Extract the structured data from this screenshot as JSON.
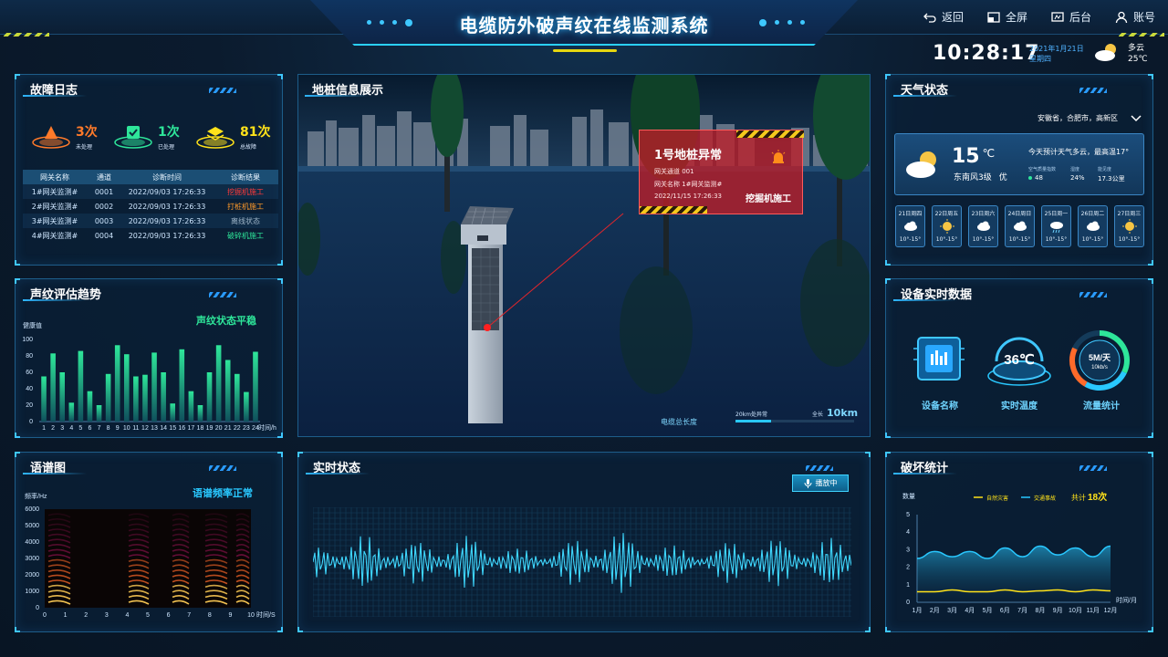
{
  "header": {
    "title": "电缆防外破声纹在线监测系统",
    "nav": [
      {
        "label": "返回",
        "icon": "back-icon"
      },
      {
        "label": "全屏",
        "icon": "fullscreen-icon"
      },
      {
        "label": "后台",
        "icon": "backend-icon"
      },
      {
        "label": "账号",
        "icon": "account-icon"
      }
    ],
    "time": "10:28:17",
    "date": "2021年1月21日",
    "weekday": "星期四",
    "weather": "多云",
    "temp": "25℃"
  },
  "fault_log": {
    "title": "故障日志",
    "stats": [
      {
        "count": "3次",
        "label": "未处理",
        "color": "#ff7a2a"
      },
      {
        "count": "1次",
        "label": "已处理",
        "color": "#2ee69a"
      },
      {
        "count": "81次",
        "label": "总故障",
        "color": "#ffe21a"
      }
    ],
    "columns": [
      "网关名称",
      "通道",
      "诊断时间",
      "诊断结果"
    ],
    "rows": [
      {
        "name": "1#网关监测#",
        "ch": "0001",
        "time": "2022/09/03 17:26:33",
        "result": "挖掘机施工",
        "color": "#ff3a3a"
      },
      {
        "name": "2#网关监测#",
        "ch": "0002",
        "time": "2022/09/03 17:26:33",
        "result": "打桩机施工",
        "color": "#ff9a2a"
      },
      {
        "name": "3#网关监测#",
        "ch": "0003",
        "time": "2022/09/03 17:26:33",
        "result": "离线状态",
        "color": "#9fb6c9"
      },
      {
        "name": "4#网关监测#",
        "ch": "0004",
        "time": "2022/09/03 17:26:33",
        "result": "破碎机施工",
        "color": "#2ee69a"
      }
    ]
  },
  "trend": {
    "title": "声纹评估趋势",
    "status": "声纹状态平稳"
  },
  "spectro": {
    "title": "语谱图",
    "status": "语谱频率正常"
  },
  "center": {
    "title": "地桩信息展示",
    "alert_title": "1号地桩异常",
    "alert_lines": [
      "网关通道    001",
      "网关名称    1#网关监测#",
      "2022/11/15 17:26:33"
    ],
    "alert_result": "挖掘机施工",
    "cable_label": "电缆总长度",
    "progress_label": "20km处异常",
    "total_prefix": "全长",
    "total_value": "10km",
    "progress": 0.3
  },
  "weather": {
    "title": "天气状态",
    "location": "安徽省，合肥市，高新区",
    "temp": "15",
    "unit": "℃",
    "wind": "东南风3级",
    "quality": "优",
    "forecast_text": "今天预计天气多云，最高温17°",
    "aqi_label": "空气质量指数",
    "aqi": "48",
    "hum_label": "湿度",
    "hum": "24%",
    "vis_label": "能见度",
    "vis": "17.3公里",
    "days": [
      {
        "name": "21日周四",
        "icon": "cloud-icon",
        "temp": "10°-15°"
      },
      {
        "name": "22日周五",
        "icon": "sun-icon",
        "temp": "10°-15°"
      },
      {
        "name": "23日周六",
        "icon": "cloud-icon",
        "temp": "10°-15°"
      },
      {
        "name": "24日周日",
        "icon": "cloud-icon",
        "temp": "10°-15°"
      },
      {
        "name": "25日周一",
        "icon": "rain-icon",
        "temp": "10°-15°"
      },
      {
        "name": "26日周二",
        "icon": "cloud-icon",
        "temp": "10°-15°"
      },
      {
        "name": "27日周三",
        "icon": "sun-icon",
        "temp": "10°-15°"
      }
    ]
  },
  "device": {
    "title": "设备实时数据",
    "items": [
      {
        "label": "设备名称",
        "icon": "device-icon"
      },
      {
        "label": "实时温度",
        "value": "36℃",
        "icon": "thermo-icon"
      },
      {
        "label": "流量统计",
        "value": "5M/天",
        "sub": "10kb/s",
        "icon": "traffic-icon"
      }
    ]
  },
  "status": {
    "title": "实时状态",
    "play": "播放中"
  },
  "damage": {
    "title": "破坏统计"
  },
  "chart_data": [
    {
      "type": "bar",
      "ylabel": "健康值",
      "xlabel": "时间/h",
      "ylim": [
        0,
        100
      ],
      "yticks": [
        0,
        20,
        40,
        60,
        80,
        100
      ],
      "categories": [
        "1",
        "2",
        "3",
        "4",
        "5",
        "6",
        "7",
        "8",
        "9",
        "10",
        "11",
        "12",
        "13",
        "14",
        "15",
        "16",
        "17",
        "18",
        "19",
        "20",
        "21",
        "22",
        "23",
        "24"
      ],
      "values": [
        55,
        83,
        60,
        23,
        86,
        37,
        20,
        58,
        93,
        82,
        55,
        57,
        84,
        60,
        22,
        88,
        37,
        20,
        60,
        93,
        75,
        58,
        36,
        85
      ]
    },
    {
      "type": "heatmap",
      "ylabel": "频率/Hz",
      "xlabel": "时间/S",
      "xlim": [
        0,
        10
      ],
      "ylim": [
        0,
        6000
      ],
      "xticks": [
        "0",
        "1",
        "2",
        "3",
        "4",
        "5",
        "6",
        "7",
        "8",
        "9",
        "10"
      ],
      "yticks": [
        0,
        1000,
        2000,
        3000,
        4000,
        5000,
        6000
      ]
    },
    {
      "type": "line",
      "title": "",
      "ylabel": "数量",
      "xlabel": "时间/月",
      "ylim": [
        0,
        5
      ],
      "yticks": [
        0,
        1,
        2,
        3,
        4,
        5
      ],
      "categories": [
        "1月",
        "2月",
        "3月",
        "4月",
        "5月",
        "6月",
        "7月",
        "8月",
        "9月",
        "10月",
        "11月",
        "12月"
      ],
      "series": [
        {
          "name": "自然灾害",
          "color": "#ffe21a",
          "values": [
            0.6,
            0.6,
            0.7,
            0.6,
            0.6,
            0.7,
            0.6,
            0.65,
            0.7,
            0.6,
            0.7,
            0.65
          ]
        },
        {
          "name": "交通事故",
          "color": "#29c8ff",
          "values": [
            2.5,
            2.9,
            2.6,
            2.9,
            2.5,
            3.1,
            2.6,
            3.2,
            2.7,
            3.1,
            2.6,
            3.2
          ]
        }
      ],
      "total_label": "共计",
      "total": "18次"
    }
  ]
}
